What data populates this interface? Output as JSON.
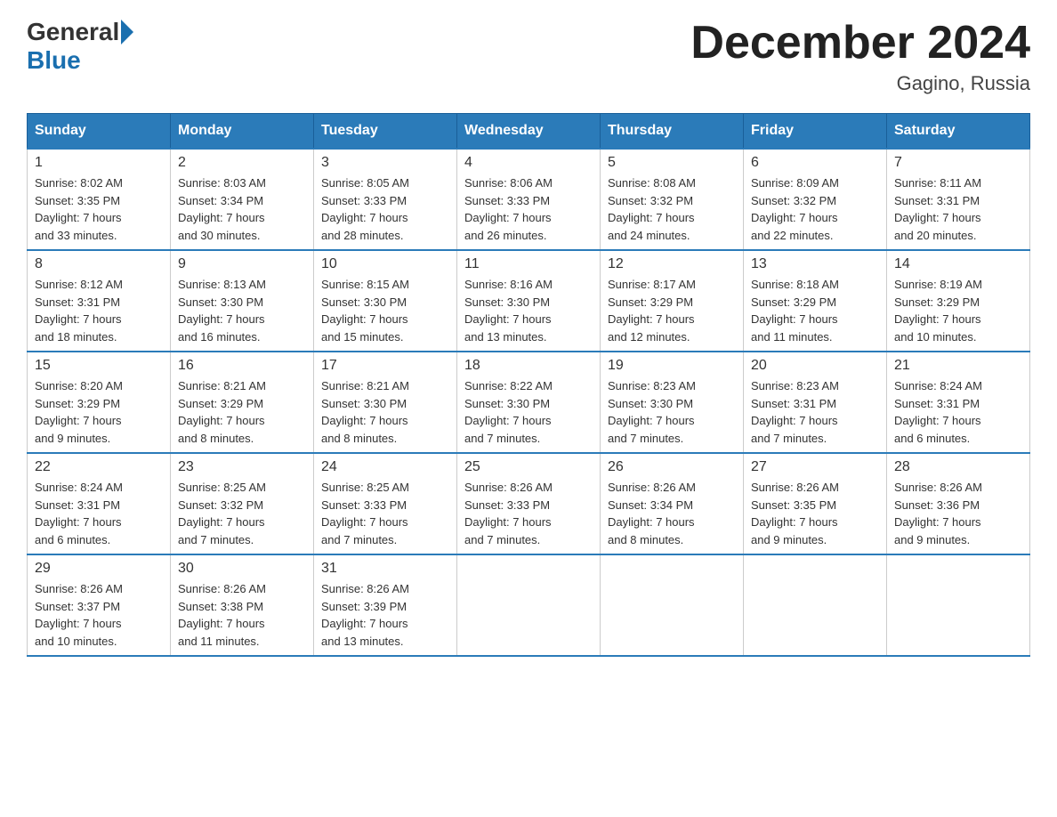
{
  "header": {
    "logo_general": "General",
    "logo_blue": "Blue",
    "month_title": "December 2024",
    "location": "Gagino, Russia"
  },
  "calendar": {
    "days_of_week": [
      "Sunday",
      "Monday",
      "Tuesday",
      "Wednesday",
      "Thursday",
      "Friday",
      "Saturday"
    ],
    "weeks": [
      [
        {
          "day": "1",
          "sunrise": "Sunrise: 8:02 AM",
          "sunset": "Sunset: 3:35 PM",
          "daylight": "Daylight: 7 hours and 33 minutes."
        },
        {
          "day": "2",
          "sunrise": "Sunrise: 8:03 AM",
          "sunset": "Sunset: 3:34 PM",
          "daylight": "Daylight: 7 hours and 30 minutes."
        },
        {
          "day": "3",
          "sunrise": "Sunrise: 8:05 AM",
          "sunset": "Sunset: 3:33 PM",
          "daylight": "Daylight: 7 hours and 28 minutes."
        },
        {
          "day": "4",
          "sunrise": "Sunrise: 8:06 AM",
          "sunset": "Sunset: 3:33 PM",
          "daylight": "Daylight: 7 hours and 26 minutes."
        },
        {
          "day": "5",
          "sunrise": "Sunrise: 8:08 AM",
          "sunset": "Sunset: 3:32 PM",
          "daylight": "Daylight: 7 hours and 24 minutes."
        },
        {
          "day": "6",
          "sunrise": "Sunrise: 8:09 AM",
          "sunset": "Sunset: 3:32 PM",
          "daylight": "Daylight: 7 hours and 22 minutes."
        },
        {
          "day": "7",
          "sunrise": "Sunrise: 8:11 AM",
          "sunset": "Sunset: 3:31 PM",
          "daylight": "Daylight: 7 hours and 20 minutes."
        }
      ],
      [
        {
          "day": "8",
          "sunrise": "Sunrise: 8:12 AM",
          "sunset": "Sunset: 3:31 PM",
          "daylight": "Daylight: 7 hours and 18 minutes."
        },
        {
          "day": "9",
          "sunrise": "Sunrise: 8:13 AM",
          "sunset": "Sunset: 3:30 PM",
          "daylight": "Daylight: 7 hours and 16 minutes."
        },
        {
          "day": "10",
          "sunrise": "Sunrise: 8:15 AM",
          "sunset": "Sunset: 3:30 PM",
          "daylight": "Daylight: 7 hours and 15 minutes."
        },
        {
          "day": "11",
          "sunrise": "Sunrise: 8:16 AM",
          "sunset": "Sunset: 3:30 PM",
          "daylight": "Daylight: 7 hours and 13 minutes."
        },
        {
          "day": "12",
          "sunrise": "Sunrise: 8:17 AM",
          "sunset": "Sunset: 3:29 PM",
          "daylight": "Daylight: 7 hours and 12 minutes."
        },
        {
          "day": "13",
          "sunrise": "Sunrise: 8:18 AM",
          "sunset": "Sunset: 3:29 PM",
          "daylight": "Daylight: 7 hours and 11 minutes."
        },
        {
          "day": "14",
          "sunrise": "Sunrise: 8:19 AM",
          "sunset": "Sunset: 3:29 PM",
          "daylight": "Daylight: 7 hours and 10 minutes."
        }
      ],
      [
        {
          "day": "15",
          "sunrise": "Sunrise: 8:20 AM",
          "sunset": "Sunset: 3:29 PM",
          "daylight": "Daylight: 7 hours and 9 minutes."
        },
        {
          "day": "16",
          "sunrise": "Sunrise: 8:21 AM",
          "sunset": "Sunset: 3:29 PM",
          "daylight": "Daylight: 7 hours and 8 minutes."
        },
        {
          "day": "17",
          "sunrise": "Sunrise: 8:21 AM",
          "sunset": "Sunset: 3:30 PM",
          "daylight": "Daylight: 7 hours and 8 minutes."
        },
        {
          "day": "18",
          "sunrise": "Sunrise: 8:22 AM",
          "sunset": "Sunset: 3:30 PM",
          "daylight": "Daylight: 7 hours and 7 minutes."
        },
        {
          "day": "19",
          "sunrise": "Sunrise: 8:23 AM",
          "sunset": "Sunset: 3:30 PM",
          "daylight": "Daylight: 7 hours and 7 minutes."
        },
        {
          "day": "20",
          "sunrise": "Sunrise: 8:23 AM",
          "sunset": "Sunset: 3:31 PM",
          "daylight": "Daylight: 7 hours and 7 minutes."
        },
        {
          "day": "21",
          "sunrise": "Sunrise: 8:24 AM",
          "sunset": "Sunset: 3:31 PM",
          "daylight": "Daylight: 7 hours and 6 minutes."
        }
      ],
      [
        {
          "day": "22",
          "sunrise": "Sunrise: 8:24 AM",
          "sunset": "Sunset: 3:31 PM",
          "daylight": "Daylight: 7 hours and 6 minutes."
        },
        {
          "day": "23",
          "sunrise": "Sunrise: 8:25 AM",
          "sunset": "Sunset: 3:32 PM",
          "daylight": "Daylight: 7 hours and 7 minutes."
        },
        {
          "day": "24",
          "sunrise": "Sunrise: 8:25 AM",
          "sunset": "Sunset: 3:33 PM",
          "daylight": "Daylight: 7 hours and 7 minutes."
        },
        {
          "day": "25",
          "sunrise": "Sunrise: 8:26 AM",
          "sunset": "Sunset: 3:33 PM",
          "daylight": "Daylight: 7 hours and 7 minutes."
        },
        {
          "day": "26",
          "sunrise": "Sunrise: 8:26 AM",
          "sunset": "Sunset: 3:34 PM",
          "daylight": "Daylight: 7 hours and 8 minutes."
        },
        {
          "day": "27",
          "sunrise": "Sunrise: 8:26 AM",
          "sunset": "Sunset: 3:35 PM",
          "daylight": "Daylight: 7 hours and 9 minutes."
        },
        {
          "day": "28",
          "sunrise": "Sunrise: 8:26 AM",
          "sunset": "Sunset: 3:36 PM",
          "daylight": "Daylight: 7 hours and 9 minutes."
        }
      ],
      [
        {
          "day": "29",
          "sunrise": "Sunrise: 8:26 AM",
          "sunset": "Sunset: 3:37 PM",
          "daylight": "Daylight: 7 hours and 10 minutes."
        },
        {
          "day": "30",
          "sunrise": "Sunrise: 8:26 AM",
          "sunset": "Sunset: 3:38 PM",
          "daylight": "Daylight: 7 hours and 11 minutes."
        },
        {
          "day": "31",
          "sunrise": "Sunrise: 8:26 AM",
          "sunset": "Sunset: 3:39 PM",
          "daylight": "Daylight: 7 hours and 13 minutes."
        },
        null,
        null,
        null,
        null
      ]
    ]
  }
}
